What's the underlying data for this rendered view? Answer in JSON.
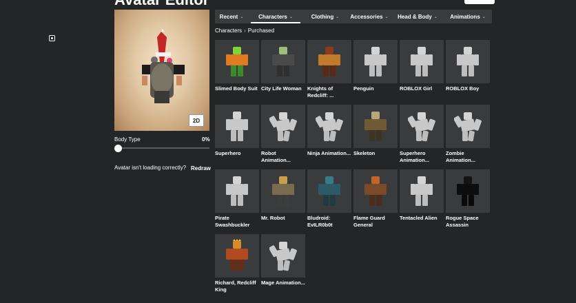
{
  "page": {
    "title": "Avatar Editor"
  },
  "avatar": {
    "view_toggle": "2D",
    "body_type_label": "Body Type",
    "body_type_value": "0%",
    "body_type_fraction": 0,
    "loading_text": "Avatar isn't loading correctly?",
    "redraw_label": "Redraw"
  },
  "tabs": [
    {
      "label": "Recent",
      "active": false
    },
    {
      "label": "Characters",
      "active": true
    },
    {
      "label": "Clothing",
      "active": false
    },
    {
      "label": "Accessories",
      "active": false
    },
    {
      "label": "Head & Body",
      "active": false
    },
    {
      "label": "Animations",
      "active": false
    }
  ],
  "breadcrumb": {
    "root": "Characters",
    "current": "Purchased"
  },
  "items": [
    {
      "name": "Slimed Body Suit",
      "thumb": "green"
    },
    {
      "name": "City Life Woman",
      "thumb": "woman"
    },
    {
      "name": "Knights of Redcliff: ...",
      "thumb": "knight"
    },
    {
      "name": "Penguin",
      "thumb": "gray"
    },
    {
      "name": "ROBLOX Girl",
      "thumb": "gray"
    },
    {
      "name": "ROBLOX Boy",
      "thumb": "gray"
    },
    {
      "name": "Superhero",
      "thumb": "gray"
    },
    {
      "name": "Robot Animation...",
      "thumb": "gray-pose"
    },
    {
      "name": "Ninja Animation...",
      "thumb": "gray-pose"
    },
    {
      "name": "Skeleton",
      "thumb": "skeleton"
    },
    {
      "name": "Superhero Animation...",
      "thumb": "gray-pose"
    },
    {
      "name": "Zombie Animation...",
      "thumb": "gray-pose"
    },
    {
      "name": "Pirate Swashbuckler",
      "thumb": "gray"
    },
    {
      "name": "Mr. Robot",
      "thumb": "robot"
    },
    {
      "name": "Bludroid: EvILR0b0t",
      "thumb": "bludroid"
    },
    {
      "name": "Flame Guard General",
      "thumb": "flame"
    },
    {
      "name": "Tentacled Alien",
      "thumb": "gray"
    },
    {
      "name": "Rogue Space Assassin",
      "thumb": "dark"
    },
    {
      "name": "Richard, Redcliff King",
      "thumb": "king"
    },
    {
      "name": "Mage Animation...",
      "thumb": "gray-pose"
    }
  ],
  "colors": {
    "background": "#232527",
    "card": "#393b3d",
    "text": "#ffffff"
  }
}
